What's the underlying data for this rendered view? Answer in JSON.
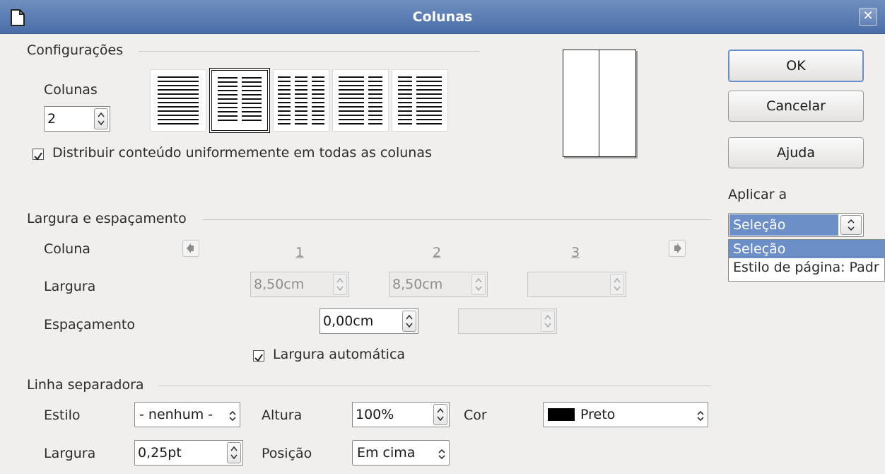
{
  "window": {
    "title": "Colunas"
  },
  "settings": {
    "title": "Configurações",
    "columns_label": "Colunas",
    "columns_value": "2",
    "distribute_label": "Distribuir conteúdo uniformemente em todas as colunas",
    "distribute_checked": true
  },
  "buttons": {
    "ok": "OK",
    "cancel": "Cancelar",
    "help": "Ajuda"
  },
  "apply_to": {
    "label": "Aplicar a",
    "value": "Seleção",
    "options": [
      "Seleção",
      "Estilo de página: Padr"
    ]
  },
  "width_spacing": {
    "title": "Largura e espaçamento",
    "column_label": "Coluna",
    "column_numbers": [
      "1",
      "2",
      "3"
    ],
    "width_label": "Largura",
    "width_values": [
      "8,50cm",
      "8,50cm",
      ""
    ],
    "spacing_label": "Espaçamento",
    "spacing_values": [
      "0,00cm",
      ""
    ],
    "auto_width_label": "Largura automática",
    "auto_width_checked": true
  },
  "separator": {
    "title": "Linha separadora",
    "style_label": "Estilo",
    "style_value": "- nenhum -",
    "height_label": "Altura",
    "height_value": "100%",
    "color_label": "Cor",
    "color_value": "Preto",
    "color_swatch": "#000000",
    "width_label": "Largura",
    "width_value": "0,25pt",
    "position_label": "Posição",
    "position_value": "Em cima"
  },
  "colors": {
    "titlebar": "#5a7db5",
    "highlight": "#6d8fc7"
  }
}
